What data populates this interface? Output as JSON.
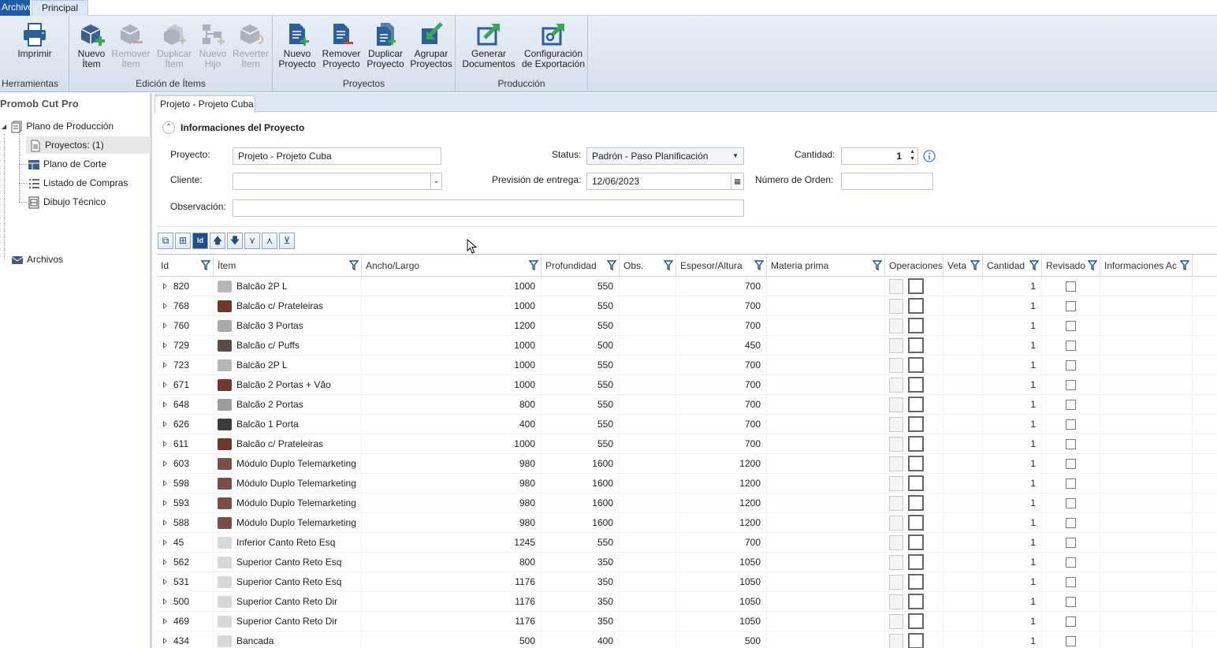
{
  "ribbon": {
    "tabs": [
      "Archivo",
      "Principal"
    ],
    "groups": {
      "herramientas": {
        "label": "Herramientas",
        "imprimir": "Imprimir"
      },
      "edicion": {
        "label": "Edición de Ítems",
        "nuevo_item": [
          "Nuevo",
          "Ítem"
        ],
        "remover_item": [
          "Remover",
          "Ítem"
        ],
        "duplicar_item": [
          "Duplicar",
          "Ítem"
        ],
        "nuevo_hijo": [
          "Nuevo",
          "Hijo"
        ],
        "reverter_item": [
          "Reverter",
          "Ítem"
        ]
      },
      "proyectos": {
        "label": "Proyectos",
        "nuevo": [
          "Nuevo",
          "Proyecto"
        ],
        "remover": [
          "Remover",
          "Proyecto"
        ],
        "duplicar": [
          "Duplicar",
          "Proyecto"
        ],
        "agrupar": [
          "Agrupar",
          "Proyectos"
        ]
      },
      "produccion": {
        "label": "Producción",
        "generar": [
          "Generar",
          "Documentos"
        ],
        "config": [
          "Configuración",
          "de Exportación"
        ]
      }
    }
  },
  "sidebar": {
    "app_title": "Promob Cut Pro",
    "tree": {
      "plano_produccion": "Plano de Producción",
      "proyectos": "Proyectos: (1)",
      "plano_corte": "Plano de Corte",
      "listado_compras": "Listado de Compras",
      "dibujo_tecnico": "Dibujo Técnico",
      "archivos": "Archivos"
    }
  },
  "document": {
    "tab": "Projeto - Projeto Cuba",
    "info_title": "Informaciones del Proyecto",
    "labels": {
      "proyecto": "Proyecto:",
      "cliente": "Cliente:",
      "observacion": "Observación:",
      "status": "Status:",
      "prevision": "Previsión de entrega:",
      "cantidad": "Cantidad:",
      "numero_orden": "Número de Orden:"
    },
    "values": {
      "proyecto": "Projeto - Projeto Cuba",
      "cliente": "",
      "observacion": "",
      "status": "Padrón - Paso Planificación",
      "prevision": "12/06/2023",
      "cantidad": "1",
      "numero_orden": ""
    }
  },
  "grid": {
    "columns": [
      "Id",
      "Ítem",
      "Ancho/Largo",
      "Profundidad",
      "Obs.",
      "Espesor/Altura",
      "Materia prima",
      "Operaciones",
      "Veta",
      "Cantidad",
      "Revisado",
      "Informaciones Ac"
    ],
    "rows": [
      {
        "id": "820",
        "item": "Balcão 2P L",
        "ancho": "1000",
        "prof": "550",
        "esp": "700",
        "cant": "1",
        "thumb": "#b7b7b7"
      },
      {
        "id": "768",
        "item": "Balcão c/ Prateleiras",
        "ancho": "1000",
        "prof": "550",
        "esp": "700",
        "cant": "1",
        "thumb": "#6b3a2a"
      },
      {
        "id": "760",
        "item": "Balcão 3 Portas",
        "ancho": "1200",
        "prof": "550",
        "esp": "700",
        "cant": "1",
        "thumb": "#a9a9a9"
      },
      {
        "id": "729",
        "item": "Balcão c/ Puffs",
        "ancho": "1000",
        "prof": "500",
        "esp": "450",
        "cant": "1",
        "thumb": "#5a4a4a"
      },
      {
        "id": "723",
        "item": "Balcão 2P L",
        "ancho": "1000",
        "prof": "550",
        "esp": "700",
        "cant": "1",
        "thumb": "#b7b7b7"
      },
      {
        "id": "671",
        "item": "Balcão 2 Portas + Vão",
        "ancho": "1000",
        "prof": "550",
        "esp": "700",
        "cant": "1",
        "thumb": "#6b3a2a"
      },
      {
        "id": "648",
        "item": "Balcão 2 Portas",
        "ancho": "800",
        "prof": "550",
        "esp": "700",
        "cant": "1",
        "thumb": "#9c9c9c"
      },
      {
        "id": "626",
        "item": "Balcão 1 Porta",
        "ancho": "400",
        "prof": "550",
        "esp": "700",
        "cant": "1",
        "thumb": "#3b3b3b"
      },
      {
        "id": "611",
        "item": "Balcão c/ Prateleiras",
        "ancho": "1000",
        "prof": "550",
        "esp": "700",
        "cant": "1",
        "thumb": "#6b3a2a"
      },
      {
        "id": "603",
        "item": "Módulo Duplo Telemarketing",
        "ancho": "980",
        "prof": "1600",
        "esp": "1200",
        "cant": "1",
        "thumb": "#7a4e44"
      },
      {
        "id": "598",
        "item": "Módulo Duplo Telemarketing",
        "ancho": "980",
        "prof": "1600",
        "esp": "1200",
        "cant": "1",
        "thumb": "#7a4e44"
      },
      {
        "id": "593",
        "item": "Módulo Duplo Telemarketing",
        "ancho": "980",
        "prof": "1600",
        "esp": "1200",
        "cant": "1",
        "thumb": "#7a4e44"
      },
      {
        "id": "588",
        "item": "Módulo Duplo Telemarketing",
        "ancho": "980",
        "prof": "1600",
        "esp": "1200",
        "cant": "1",
        "thumb": "#7a4e44"
      },
      {
        "id": "45",
        "item": "Inferior Canto Reto Esq",
        "ancho": "1245",
        "prof": "550",
        "esp": "700",
        "cant": "1",
        "thumb": "#d8d8d8"
      },
      {
        "id": "562",
        "item": "Superior Canto Reto Esq",
        "ancho": "800",
        "prof": "350",
        "esp": "1050",
        "cant": "1",
        "thumb": "#d8d8d8"
      },
      {
        "id": "531",
        "item": "Superior Canto Reto Esq",
        "ancho": "1176",
        "prof": "350",
        "esp": "1050",
        "cant": "1",
        "thumb": "#d8d8d8"
      },
      {
        "id": "500",
        "item": "Superior Canto Reto Dir",
        "ancho": "1176",
        "prof": "350",
        "esp": "1050",
        "cant": "1",
        "thumb": "#d8d8d8"
      },
      {
        "id": "469",
        "item": "Superior Canto Reto Dir",
        "ancho": "1176",
        "prof": "350",
        "esp": "1050",
        "cant": "1",
        "thumb": "#d8d8d8"
      },
      {
        "id": "434",
        "item": "Bancada",
        "ancho": "500",
        "prof": "400",
        "esp": "500",
        "cant": "1",
        "thumb": "#d8d8d8"
      }
    ]
  },
  "colors": {
    "accent": "#1e5aa8",
    "icon_green": "#3aa65a",
    "icon_blue": "#2f5f97",
    "icon_gray": "#9aa3ad"
  }
}
